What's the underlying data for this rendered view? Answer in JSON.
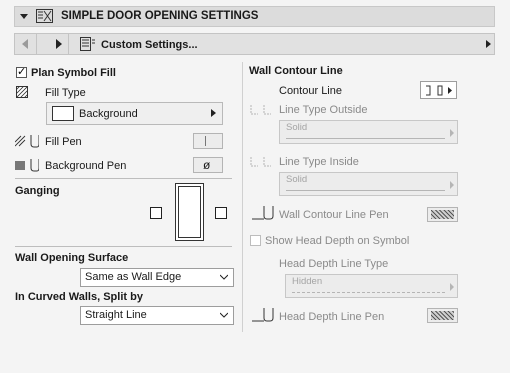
{
  "header": {
    "title": "SIMPLE DOOR OPENING SETTINGS"
  },
  "nav": {
    "preset": "Custom Settings..."
  },
  "left": {
    "plan_symbol_fill": {
      "label": "Plan Symbol Fill",
      "checked": true
    },
    "fill_type": {
      "label": "Fill Type",
      "value": "Background"
    },
    "fill_pen": {
      "label": "Fill Pen"
    },
    "background_pen": {
      "label": "Background Pen"
    },
    "ganging": {
      "label": "Ganging"
    },
    "wall_opening_surface": {
      "label": "Wall Opening Surface",
      "value": "Same as Wall Edge"
    },
    "curved_walls": {
      "label": "In Curved Walls, Split by",
      "value": "Straight Line"
    }
  },
  "right": {
    "section_title": "Wall Contour Line",
    "contour_line": {
      "label": "Contour Line"
    },
    "line_type_outside": {
      "label": "Line Type Outside",
      "value": "Solid"
    },
    "line_type_inside": {
      "label": "Line Type Inside",
      "value": "Solid"
    },
    "wall_contour_line_pen": {
      "label": "Wall Contour Line Pen"
    },
    "show_head_depth": {
      "label": "Show Head Depth on Symbol",
      "checked": false
    },
    "head_depth_line_type": {
      "label": "Head Depth Line Type",
      "value": "Hidden"
    },
    "head_depth_line_pen": {
      "label": "Head Depth Line Pen"
    }
  }
}
